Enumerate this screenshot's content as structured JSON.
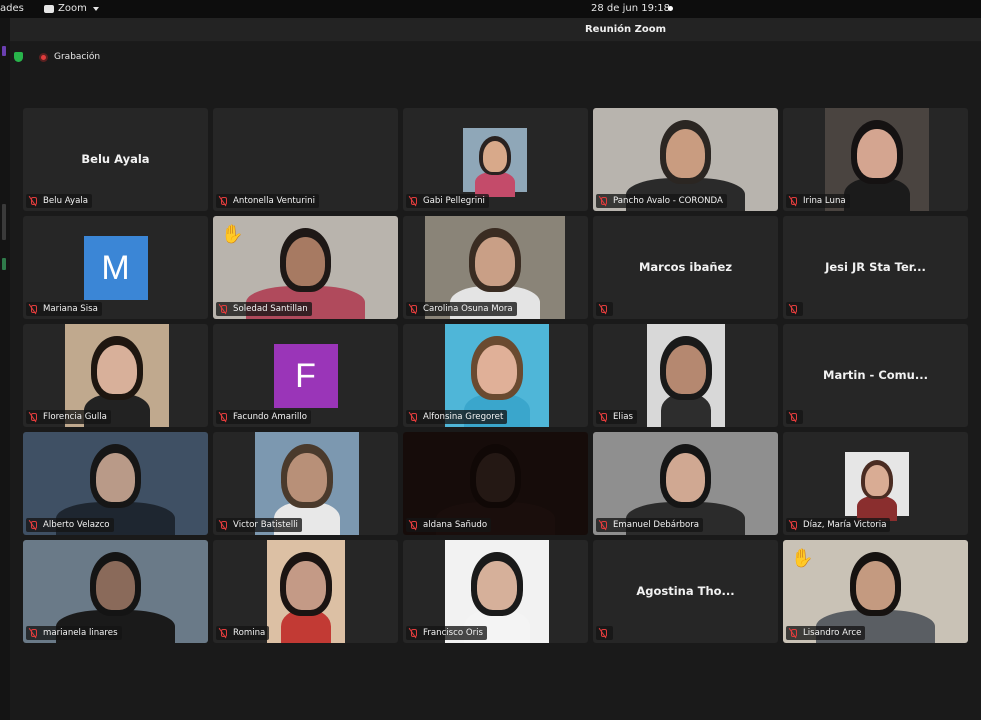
{
  "topbar": {
    "activities": "ades",
    "app_name": "Zoom",
    "clock": "28 de jun  19:18"
  },
  "window": {
    "title": "Reunión Zoom"
  },
  "status": {
    "recording_label": "Grabación"
  },
  "colors": {
    "muted_mic": "#e03c3c",
    "shield": "#28b44b",
    "tile_bg": "#262626",
    "raised_hand": "#f5b82e"
  },
  "participants": [
    {
      "name": "Belu Ayala",
      "center_text": "Belu Ayala",
      "muted": true
    },
    {
      "name": "Antonella Venturini",
      "muted": true
    },
    {
      "name": "Gabi Pellegrini",
      "muted": true
    },
    {
      "name": "Pancho Avalo - CORONDA",
      "muted": true
    },
    {
      "name": "Irina Luna",
      "muted": true
    },
    {
      "name": "Mariana Sisa",
      "avatar_letter": "M",
      "muted": true
    },
    {
      "name": "Soledad Santillan",
      "hand_raised": true,
      "muted": true
    },
    {
      "name": "Carolina Osuna Mora",
      "muted": true
    },
    {
      "name": "",
      "center_text": "Marcos ibañez",
      "muted": true
    },
    {
      "name": "",
      "center_text": "Jesi JR Sta Ter...",
      "muted": true
    },
    {
      "name": "Florencia Gulla",
      "muted": true
    },
    {
      "name": "Facundo Amarillo",
      "avatar_letter": "F",
      "muted": true
    },
    {
      "name": "Alfonsina Gregoret",
      "muted": true
    },
    {
      "name": "Elias",
      "muted": true
    },
    {
      "name": "",
      "center_text": "Martin - Comu...",
      "muted": true
    },
    {
      "name": "Alberto Velazco",
      "muted": true
    },
    {
      "name": "Victor Batistelli",
      "muted": true
    },
    {
      "name": "aldana Sañudo",
      "muted": true
    },
    {
      "name": "Emanuel Debárbora",
      "muted": true
    },
    {
      "name": "Díaz, María Victoria",
      "muted": true
    },
    {
      "name": "marianela linares",
      "muted": true
    },
    {
      "name": "Romina",
      "muted": true
    },
    {
      "name": "Francisco Oris",
      "muted": true
    },
    {
      "name": "",
      "center_text": "Agostina Tho...",
      "muted": true
    },
    {
      "name": "Lisandro Arce",
      "hand_raised": true,
      "muted": true
    }
  ]
}
